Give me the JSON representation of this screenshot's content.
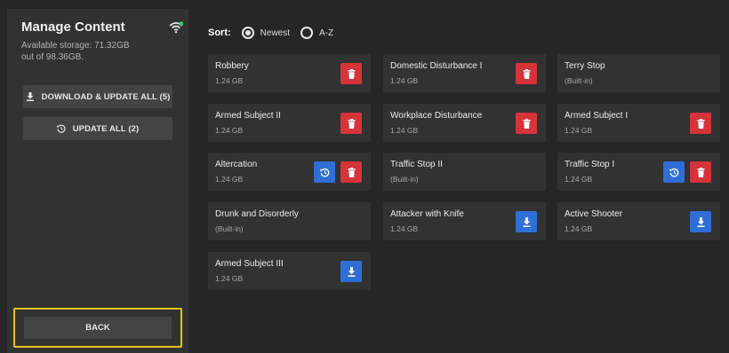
{
  "sidebar": {
    "title": "Manage Content",
    "storage_line1": "Available storage: 71.32GB",
    "storage_line2": "out of 98.36GB.",
    "download_update_all": "DOWNLOAD & UPDATE ALL (5)",
    "update_all": "UPDATE ALL (2)",
    "back": "BACK"
  },
  "sort": {
    "label": "Sort:",
    "options": [
      "Newest",
      "A-Z"
    ],
    "selected": "Newest"
  },
  "colors": {
    "delete": "#d5343b",
    "action": "#2f6fd5",
    "highlight": "#e7c31c",
    "wifi_dot": "#2ecc71"
  },
  "items": [
    {
      "name": "Robbery",
      "size": "1.24 GB",
      "actions": [
        "delete-icon"
      ]
    },
    {
      "name": "Domestic Disturbance I",
      "size": "1.24 GB",
      "actions": [
        "delete-icon"
      ]
    },
    {
      "name": "Terry Stop",
      "size": "(Built-in)",
      "actions": []
    },
    {
      "name": "Armed Subject II",
      "size": "1.24 GB",
      "actions": [
        "delete-icon"
      ]
    },
    {
      "name": "Workplace Disturbance",
      "size": "1.24 GB",
      "actions": [
        "delete-icon"
      ]
    },
    {
      "name": "Armed Subject I",
      "size": "1.24 GB",
      "actions": [
        "delete-icon"
      ]
    },
    {
      "name": "Altercation",
      "size": "1.24 GB",
      "actions": [
        "update-icon",
        "delete-icon"
      ]
    },
    {
      "name": "Traffic Stop II",
      "size": "(Built-in)",
      "actions": []
    },
    {
      "name": "Traffic Stop I",
      "size": "1.24 GB",
      "actions": [
        "update-icon",
        "delete-icon"
      ]
    },
    {
      "name": "Drunk and Disorderly",
      "size": "(Built-in)",
      "actions": []
    },
    {
      "name": "Attacker with Knife",
      "size": "1.24 GB",
      "actions": [
        "download-icon"
      ]
    },
    {
      "name": "Active Shooter",
      "size": "1.24 GB",
      "actions": [
        "download-icon"
      ]
    },
    {
      "name": "Armed Subject  III",
      "size": "1.24 GB",
      "actions": [
        "download-icon"
      ]
    }
  ]
}
